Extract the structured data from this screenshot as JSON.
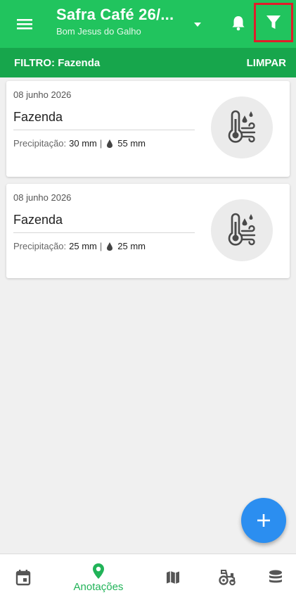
{
  "header": {
    "title": "Safra Café 26/...",
    "subtitle": "Bom Jesus do Galho",
    "accent_color": "#21c45e"
  },
  "filter": {
    "label": "FILTRO: Fazenda",
    "clear_label": "LIMPAR"
  },
  "cards": [
    {
      "date": "08 junho 2026",
      "name": "Fazenda",
      "precip_label": "Precipitação:",
      "precip_value": "30 mm",
      "separator": "|",
      "drop_value": "55 mm",
      "icon": "weather-thermometer-icon"
    },
    {
      "date": "08 junho 2026",
      "name": "Fazenda",
      "precip_label": "Precipitação:",
      "precip_value": "25 mm",
      "separator": "|",
      "drop_value": "25 mm",
      "icon": "weather-thermometer-icon"
    }
  ],
  "fab": {
    "icon": "plus-icon",
    "color": "#2b8ef0"
  },
  "bottom_nav": {
    "items": [
      {
        "icon": "calendar-icon",
        "label": ""
      },
      {
        "icon": "location-pin-icon",
        "label": "Anotações",
        "active": true
      },
      {
        "icon": "map-icon",
        "label": ""
      },
      {
        "icon": "tractor-icon",
        "label": ""
      },
      {
        "icon": "database-icon",
        "label": ""
      }
    ]
  }
}
